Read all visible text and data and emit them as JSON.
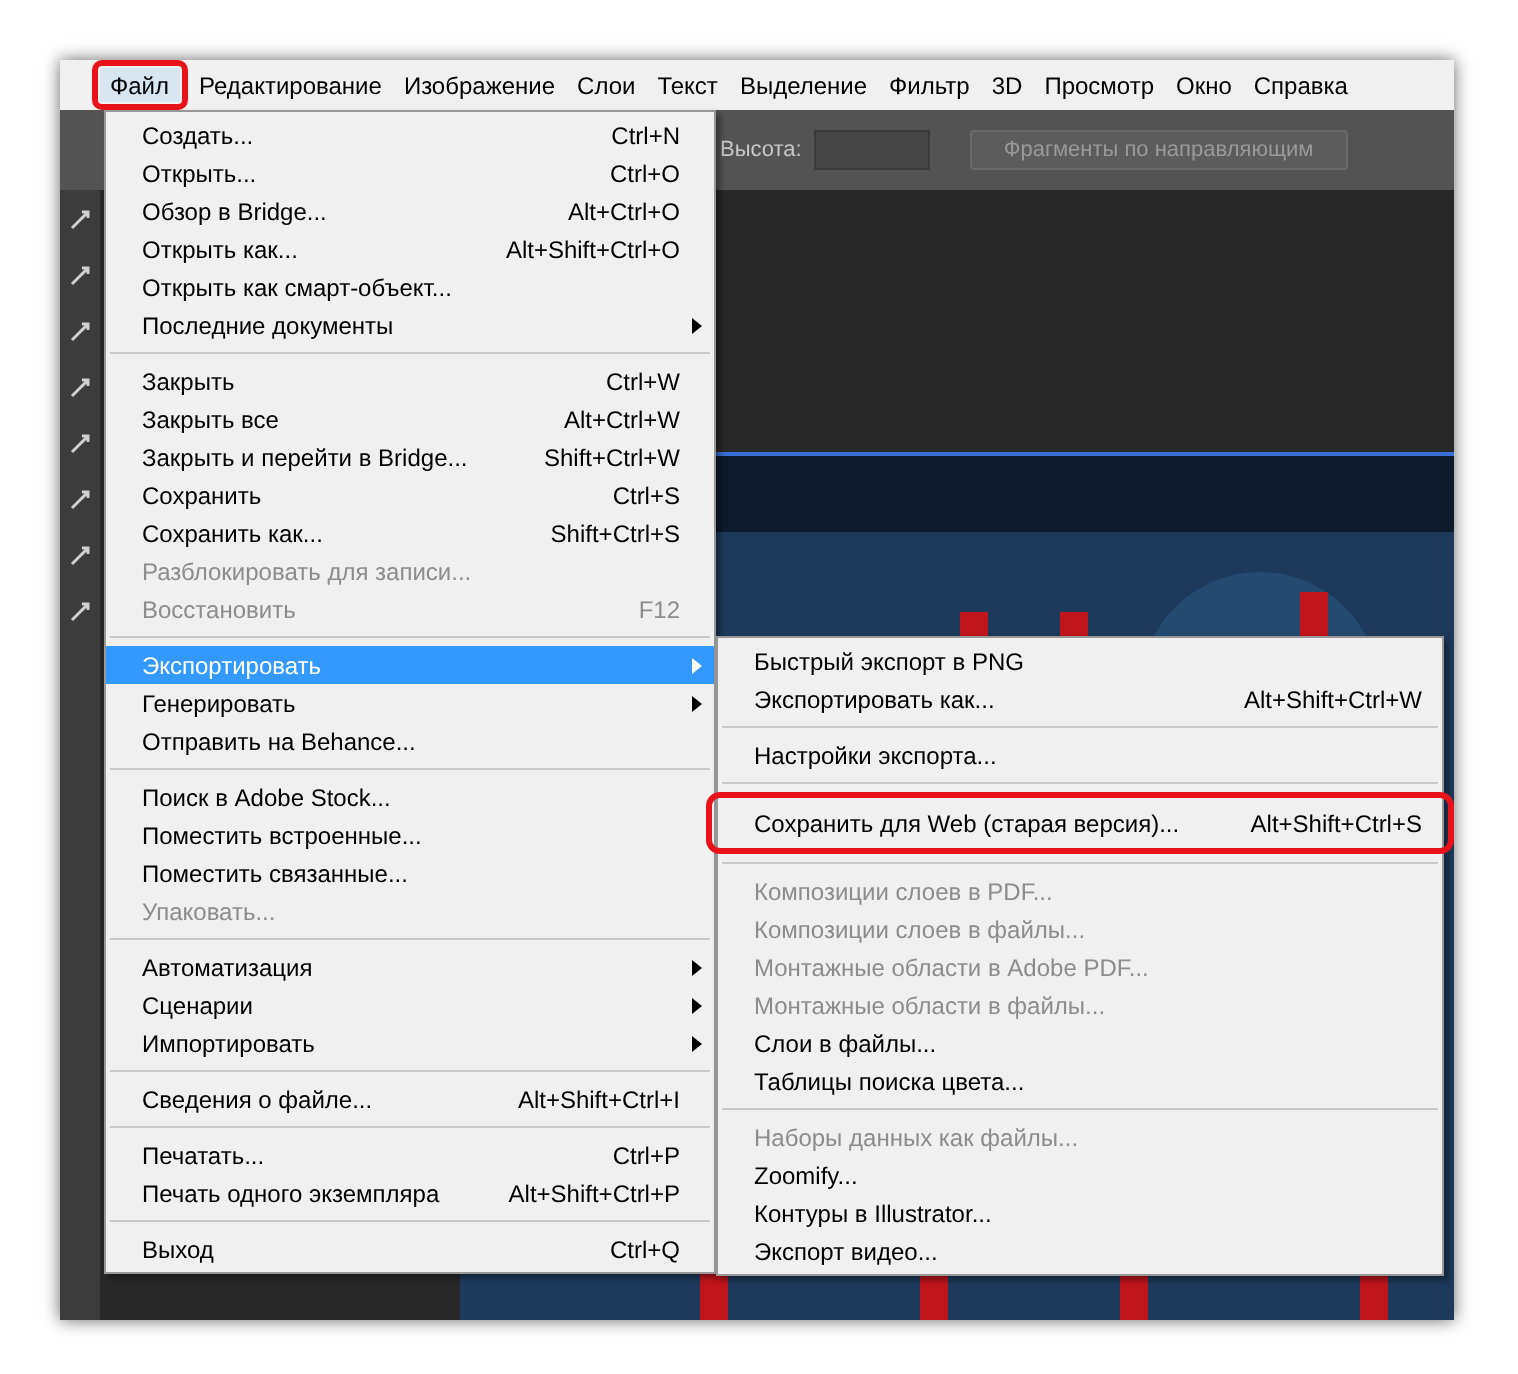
{
  "menubar": [
    {
      "label": "Файл",
      "selected": true,
      "framed": true
    },
    {
      "label": "Редактирование",
      "selected": false,
      "framed": false
    },
    {
      "label": "Изображение",
      "selected": false,
      "framed": false
    },
    {
      "label": "Слои",
      "selected": false,
      "framed": false
    },
    {
      "label": "Текст",
      "selected": false,
      "framed": false
    },
    {
      "label": "Выделение",
      "selected": false,
      "framed": false
    },
    {
      "label": "Фильтр",
      "selected": false,
      "framed": false
    },
    {
      "label": "3D",
      "selected": false,
      "framed": false
    },
    {
      "label": "Просмотр",
      "selected": false,
      "framed": false
    },
    {
      "label": "Окно",
      "selected": false,
      "framed": false
    },
    {
      "label": "Справка",
      "selected": false,
      "framed": false
    }
  ],
  "options_bar": {
    "height_label": "Высота:",
    "button": "Фрагменты по направляющим"
  },
  "canvas": {
    "kind": "picture"
  },
  "file_menu": [
    [
      {
        "label": "Создать...",
        "shortcut": "Ctrl+N",
        "disabled": false,
        "submenu": false,
        "selected": false
      },
      {
        "label": "Открыть...",
        "shortcut": "Ctrl+O",
        "disabled": false,
        "submenu": false,
        "selected": false
      },
      {
        "label": "Обзор в Bridge...",
        "shortcut": "Alt+Ctrl+O",
        "disabled": false,
        "submenu": false,
        "selected": false
      },
      {
        "label": "Открыть как...",
        "shortcut": "Alt+Shift+Ctrl+O",
        "disabled": false,
        "submenu": false,
        "selected": false
      },
      {
        "label": "Открыть как смарт-объект...",
        "disabled": false,
        "submenu": false,
        "selected": false
      },
      {
        "label": "Последние документы",
        "disabled": false,
        "submenu": true,
        "selected": false
      }
    ],
    [
      {
        "label": "Закрыть",
        "shortcut": "Ctrl+W",
        "disabled": false,
        "submenu": false,
        "selected": false
      },
      {
        "label": "Закрыть все",
        "shortcut": "Alt+Ctrl+W",
        "disabled": false,
        "submenu": false,
        "selected": false
      },
      {
        "label": "Закрыть и перейти в Bridge...",
        "shortcut": "Shift+Ctrl+W",
        "disabled": false,
        "submenu": false,
        "selected": false
      },
      {
        "label": "Сохранить",
        "shortcut": "Ctrl+S",
        "disabled": false,
        "submenu": false,
        "selected": false
      },
      {
        "label": "Сохранить как...",
        "shortcut": "Shift+Ctrl+S",
        "disabled": false,
        "submenu": false,
        "selected": false
      },
      {
        "label": "Разблокировать для записи...",
        "disabled": true,
        "submenu": false,
        "selected": false
      },
      {
        "label": "Восстановить",
        "shortcut": "F12",
        "disabled": true,
        "submenu": false,
        "selected": false
      }
    ],
    [
      {
        "label": "Экспортировать",
        "disabled": false,
        "submenu": true,
        "selected": true
      },
      {
        "label": "Генерировать",
        "disabled": false,
        "submenu": true,
        "selected": false
      },
      {
        "label": "Отправить на Behance...",
        "disabled": false,
        "submenu": false,
        "selected": false
      }
    ],
    [
      {
        "label": "Поиск в Adobe Stock...",
        "disabled": false,
        "submenu": false,
        "selected": false
      },
      {
        "label": "Поместить встроенные...",
        "disabled": false,
        "submenu": false,
        "selected": false
      },
      {
        "label": "Поместить связанные...",
        "disabled": false,
        "submenu": false,
        "selected": false
      },
      {
        "label": "Упаковать...",
        "disabled": true,
        "submenu": false,
        "selected": false
      }
    ],
    [
      {
        "label": "Автоматизация",
        "disabled": false,
        "submenu": true,
        "selected": false
      },
      {
        "label": "Сценарии",
        "disabled": false,
        "submenu": true,
        "selected": false
      },
      {
        "label": "Импортировать",
        "disabled": false,
        "submenu": true,
        "selected": false
      }
    ],
    [
      {
        "label": "Сведения о файле...",
        "shortcut": "Alt+Shift+Ctrl+I",
        "disabled": false,
        "submenu": false,
        "selected": false
      }
    ],
    [
      {
        "label": "Печатать...",
        "shortcut": "Ctrl+P",
        "disabled": false,
        "submenu": false,
        "selected": false
      },
      {
        "label": "Печать одного экземпляра",
        "shortcut": "Alt+Shift+Ctrl+P",
        "disabled": false,
        "submenu": false,
        "selected": false
      }
    ],
    [
      {
        "label": "Выход",
        "shortcut": "Ctrl+Q",
        "disabled": false,
        "submenu": false,
        "selected": false
      }
    ]
  ],
  "export_submenu": [
    [
      {
        "label": "Быстрый экспорт в PNG",
        "disabled": false,
        "framed": false
      },
      {
        "label": "Экспортировать как...",
        "shortcut": "Alt+Shift+Ctrl+W",
        "disabled": false,
        "framed": false
      }
    ],
    [
      {
        "label": "Настройки экспорта...",
        "disabled": false,
        "framed": false
      }
    ],
    [
      {
        "label": "Сохранить для Web (старая версия)...",
        "shortcut": "Alt+Shift+Ctrl+S",
        "disabled": false,
        "framed": true
      }
    ],
    [
      {
        "label": "Композиции слоев в PDF...",
        "disabled": true,
        "framed": false
      },
      {
        "label": "Композиции слоев в файлы...",
        "disabled": true,
        "framed": false
      },
      {
        "label": "Монтажные области в Adobe PDF...",
        "disabled": true,
        "framed": false
      },
      {
        "label": "Монтажные области в файлы...",
        "disabled": true,
        "framed": false
      },
      {
        "label": "Слои в файлы...",
        "disabled": false,
        "framed": false
      },
      {
        "label": "Таблицы поиска цвета...",
        "disabled": false,
        "framed": false
      }
    ],
    [
      {
        "label": "Наборы данных как файлы...",
        "disabled": true,
        "framed": false
      },
      {
        "label": "Zoomify...",
        "disabled": false,
        "framed": false
      },
      {
        "label": "Контуры в Illustrator...",
        "disabled": false,
        "framed": false
      },
      {
        "label": "Экспорт видео...",
        "disabled": false,
        "framed": false
      }
    ]
  ]
}
